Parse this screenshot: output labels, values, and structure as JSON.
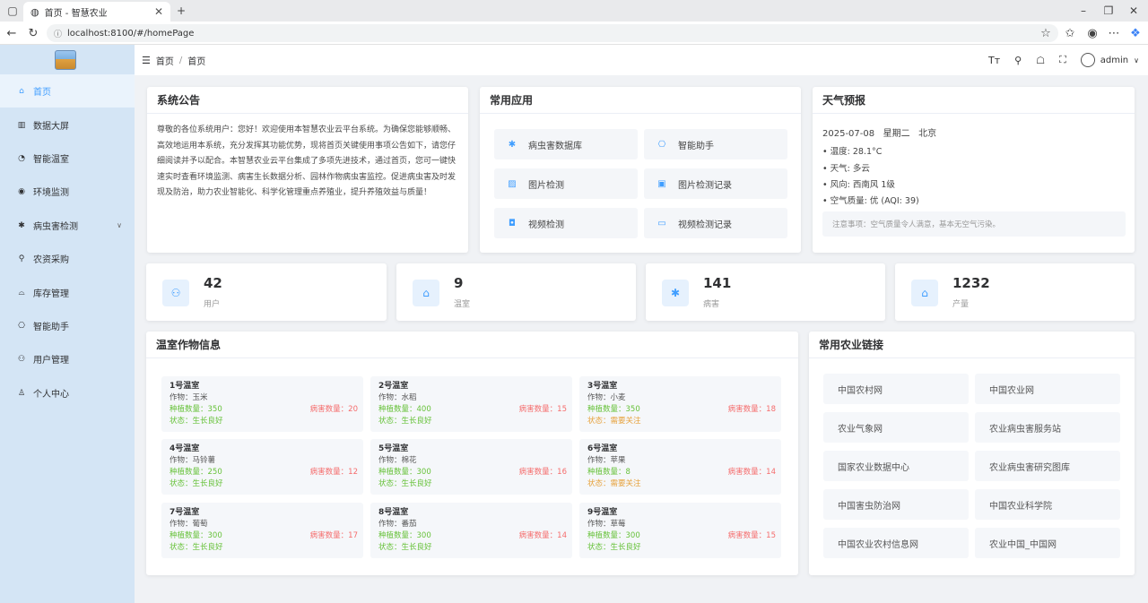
{
  "browser": {
    "tab_title": "首页 - 智慧农业",
    "url": "localhost:8100/#/homePage"
  },
  "sidebar": {
    "items": [
      {
        "label": "首页",
        "icon": "home-icon"
      },
      {
        "label": "数据大屏",
        "icon": "chart-icon"
      },
      {
        "label": "智能温室",
        "icon": "greenhouse-icon"
      },
      {
        "label": "环境监测",
        "icon": "monitor-icon"
      },
      {
        "label": "病虫害检测",
        "icon": "bug-icon"
      },
      {
        "label": "农资采购",
        "icon": "cart-icon"
      },
      {
        "label": "库存管理",
        "icon": "warehouse-icon"
      },
      {
        "label": "智能助手",
        "icon": "robot-icon"
      },
      {
        "label": "用户管理",
        "icon": "users-icon"
      },
      {
        "label": "个人中心",
        "icon": "user-icon"
      }
    ]
  },
  "header": {
    "breadcrumb": [
      "首页",
      "首页"
    ],
    "user": "admin"
  },
  "notice": {
    "title": "系统公告",
    "text": "尊敬的各位系统用户：您好！欢迎使用本智慧农业云平台系统。为确保您能够顺畅、高效地运用本系统，充分发挥其功能优势，现将首页关键使用事项公告如下，请您仔细阅读并予以配合。本智慧农业云平台集成了多项先进技术，通过首页，您可一键快速实时查看环境监测、病害生长数据分析、园林作物病虫害监控。促进病虫害及时发现及防治，助力农业智能化、科学化管理重点养殖业，提升养殖效益与质量！"
  },
  "apps": {
    "title": "常用应用",
    "items": [
      "病虫害数据库",
      "智能助手",
      "图片检测",
      "图片检测记录",
      "视频检测",
      "视频检测记录"
    ]
  },
  "weather": {
    "title": "天气预报",
    "date_line": "2025-07-08   星期二   北京",
    "lines": [
      "温度: 28.1°C",
      "天气: 多云",
      "风向: 西南风 1级",
      "空气质量: 优 (AQI: 39)"
    ],
    "note": "注意事项：空气质量令人满意，基本无空气污染。"
  },
  "stats": [
    {
      "value": "42",
      "label": "用户"
    },
    {
      "value": "9",
      "label": "温室"
    },
    {
      "value": "141",
      "label": "病害"
    },
    {
      "value": "1232",
      "label": "产量"
    }
  ],
  "greenhouses": {
    "title": "温室作物信息",
    "items": [
      {
        "name": "1号温室",
        "crop": "作物：玉米",
        "plant": "种植数量：350",
        "pest": "病害数量：20",
        "status": "状态：生长良好",
        "warn": false
      },
      {
        "name": "2号温室",
        "crop": "作物：水稻",
        "plant": "种植数量：400",
        "pest": "病害数量：15",
        "status": "状态：生长良好",
        "warn": false
      },
      {
        "name": "3号温室",
        "crop": "作物：小麦",
        "plant": "种植数量：350",
        "pest": "病害数量：18",
        "status": "状态：需要关注",
        "warn": true
      },
      {
        "name": "4号温室",
        "crop": "作物：马铃薯",
        "plant": "种植数量：250",
        "pest": "病害数量：12",
        "status": "状态：生长良好",
        "warn": false
      },
      {
        "name": "5号温室",
        "crop": "作物：棉花",
        "plant": "种植数量：300",
        "pest": "病害数量：16",
        "status": "状态：生长良好",
        "warn": false
      },
      {
        "name": "6号温室",
        "crop": "作物：苹果",
        "plant": "种植数量：8",
        "pest": "病害数量：14",
        "status": "状态：需要关注",
        "warn": true
      },
      {
        "name": "7号温室",
        "crop": "作物：葡萄",
        "plant": "种植数量：300",
        "pest": "病害数量：17",
        "status": "状态：生长良好",
        "warn": false
      },
      {
        "name": "8号温室",
        "crop": "作物：番茄",
        "plant": "种植数量：300",
        "pest": "病害数量：14",
        "status": "状态：生长良好",
        "warn": false
      },
      {
        "name": "9号温室",
        "crop": "作物：草莓",
        "plant": "种植数量：300",
        "pest": "病害数量：15",
        "status": "状态：生长良好",
        "warn": false
      }
    ]
  },
  "links": {
    "title": "常用农业链接",
    "items": [
      "中国农村网",
      "中国农业网",
      "农业气象网",
      "农业病虫害服务站",
      "国家农业数据中心",
      "农业病虫害研究图库",
      "中国害虫防治网",
      "中国农业科学院",
      "中国农业农村信息网",
      "农业中国_中国网"
    ]
  },
  "colors": {
    "accent": "#409eff",
    "sidebar_bg": "#d4e5f5",
    "ok": "#67c23a",
    "warn": "#e6a23c",
    "danger": "#f56c6c"
  }
}
